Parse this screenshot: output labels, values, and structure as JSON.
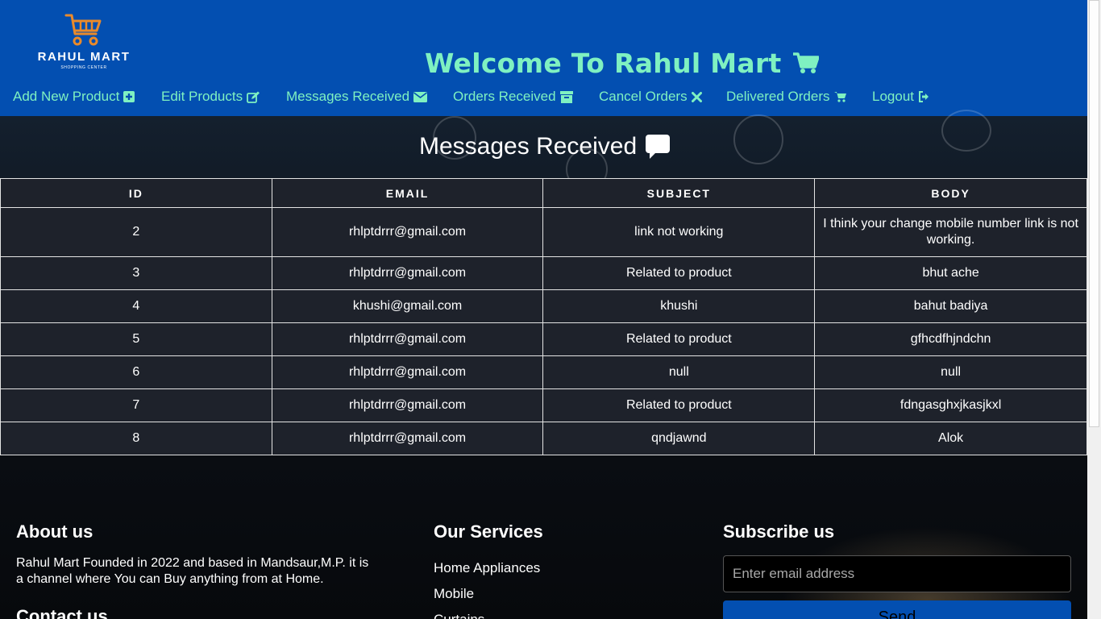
{
  "brand": {
    "name": "RAHUL MART",
    "tagline": "SHOPPING CENTER",
    "welcome": "Welcome To Rahul Mart"
  },
  "nav": [
    {
      "label": "Add New Product",
      "icon": "plus-square-icon"
    },
    {
      "label": "Edit Products",
      "icon": "edit-icon"
    },
    {
      "label": "Messages Received",
      "icon": "envelope-icon"
    },
    {
      "label": "Orders Received",
      "icon": "archive-icon"
    },
    {
      "label": "Cancel Orders",
      "icon": "times-icon"
    },
    {
      "label": "Delivered Orders",
      "icon": "cart-icon"
    },
    {
      "label": "Logout",
      "icon": "sign-out-icon"
    }
  ],
  "page": {
    "title": "Messages Received",
    "title_icon": "comment-icon"
  },
  "table": {
    "columns": [
      "ID",
      "EMAIL",
      "SUBJECT",
      "BODY"
    ],
    "rows": [
      [
        "2",
        "rhlptdrrr@gmail.com",
        "link not working",
        "I think your change mobile number link is not working."
      ],
      [
        "3",
        "rhlptdrrr@gmail.com",
        "Related to product",
        "bhut ache"
      ],
      [
        "4",
        "khushi@gmail.com",
        "khushi",
        "bahut badiya"
      ],
      [
        "5",
        "rhlptdrrr@gmail.com",
        "Related to product",
        "gfhcdfhjndchn"
      ],
      [
        "6",
        "rhlptdrrr@gmail.com",
        "null",
        "null"
      ],
      [
        "7",
        "rhlptdrrr@gmail.com",
        "Related to product",
        "fdngasghxjkasjkxl"
      ],
      [
        "8",
        "rhlptdrrr@gmail.com",
        "qndjawnd",
        "Alok"
      ]
    ]
  },
  "footer": {
    "about_title": "About us",
    "about_text": "Rahul Mart Founded in 2022 and based in Mandsaur,M.P. it is a channel where You can Buy anything from at Home.",
    "contact_title": "Contact us",
    "services_title": "Our Services",
    "services": [
      "Home Appliances",
      "Mobile",
      "Curtains"
    ],
    "subscribe_title": "Subscribe us",
    "email_placeholder": "Enter email address",
    "send_label": "Send"
  },
  "colors": {
    "header_bg": "#034fb1",
    "accent": "#7ff1c1",
    "table_bg": "#1e222b"
  }
}
